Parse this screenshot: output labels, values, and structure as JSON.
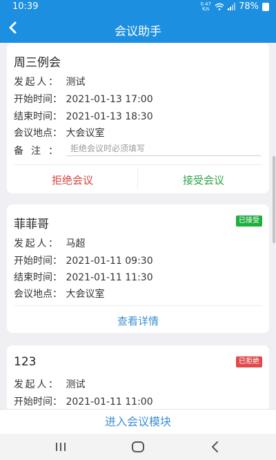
{
  "status_bar": {
    "time": "10:39",
    "net_speed_value": "0.47",
    "net_speed_unit": "K/s",
    "battery": "78%"
  },
  "header": {
    "title": "会议助手"
  },
  "meetings": [
    {
      "title": "周三例会",
      "initiator_label": "发起人：",
      "initiator": "测试",
      "start_label": "开始时间：",
      "start": "2021-01-13 17:00",
      "end_label": "结束时间：",
      "end": "2021-01-13 18:30",
      "location_label": "会议地点：",
      "location": "大会议室",
      "remark_label": "备注：",
      "remark_placeholder": "拒绝会议时必须填写",
      "reject_label": "拒绝会议",
      "accept_label": "接受会议"
    },
    {
      "title": "菲菲哥",
      "status": "已接受",
      "initiator_label": "发起人：",
      "initiator": "马超",
      "start_label": "开始时间：",
      "start": "2021-01-11 09:30",
      "end_label": "结束时间：",
      "end": "2021-01-11 11:30",
      "location_label": "会议地点：",
      "location": "大会议室",
      "detail_label": "查看详情"
    },
    {
      "title": "123",
      "status": "已拒绝",
      "initiator_label": "发起人：",
      "initiator": "测试",
      "start_label": "开始时间：",
      "start": "2021-01-11 11:00"
    }
  ],
  "footer": {
    "enter_label": "进入会议模块"
  },
  "colors": {
    "primary": "#1d8fe0",
    "reject": "#d9413a",
    "accept": "#2ea14a",
    "accepted_badge": "#1fae3c",
    "rejected_badge": "#e04a4a",
    "link": "#3d8fd6"
  },
  "icons": {
    "back": "back-arrow-icon",
    "wifi": "wifi-icon",
    "signal": "signal-icon",
    "battery": "battery-icon",
    "nav_recents": "recents-icon",
    "nav_home": "home-icon",
    "nav_back": "nav-back-icon"
  }
}
